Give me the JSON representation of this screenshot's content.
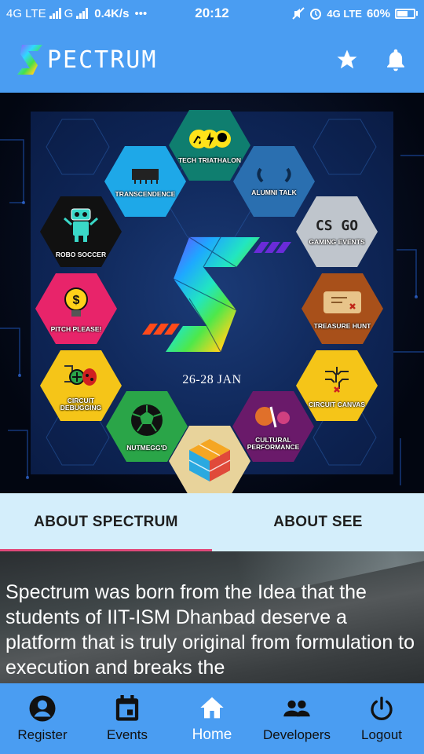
{
  "status_bar": {
    "network_left": "4G LTE",
    "network_mid": "G",
    "speed": "0.4K/s",
    "dots": "•••",
    "time": "20:12",
    "network_right": "4G LTE",
    "battery": "60%",
    "battery_level": 0.6
  },
  "app_bar": {
    "logo_text": "PECTRUM",
    "icons": [
      "star-icon",
      "bell-icon"
    ]
  },
  "poster": {
    "date": "26-28 JAN",
    "events": [
      "TECH TRIATHALON",
      "ALUMNI TALK",
      "GAMING EVENTS",
      "TREASURE HUNT",
      "CIRCUIT CANVAS",
      "CULTURAL PERFORMANCE",
      "NUTMEGG'D",
      "CIRCUIT DEBUGGING",
      "PITCH PLEASE!",
      "ROBO SOCCER",
      "TRANSCENDENCE"
    ],
    "csgo_text": "CS GO"
  },
  "tabs": [
    {
      "label": "ABOUT SPECTRUM",
      "active": true
    },
    {
      "label": "ABOUT SEE",
      "active": false
    }
  ],
  "content": {
    "text": "Spectrum was born from the Idea that the students of IIT-ISM Dhanbad deserve a platform that is truly original from formulation to execution and breaks the"
  },
  "bottom_nav": [
    {
      "label": "Register",
      "icon": "account-circle-icon",
      "active": false
    },
    {
      "label": "Events",
      "icon": "calendar-icon",
      "active": false
    },
    {
      "label": "Home",
      "icon": "home-icon",
      "active": true
    },
    {
      "label": "Developers",
      "icon": "people-icon",
      "active": false
    },
    {
      "label": "Logout",
      "icon": "power-icon",
      "active": false
    }
  ],
  "colors": {
    "primary": "#4a9df2",
    "tab_bg": "#d4eefb",
    "tab_indicator": "#e0497a"
  }
}
